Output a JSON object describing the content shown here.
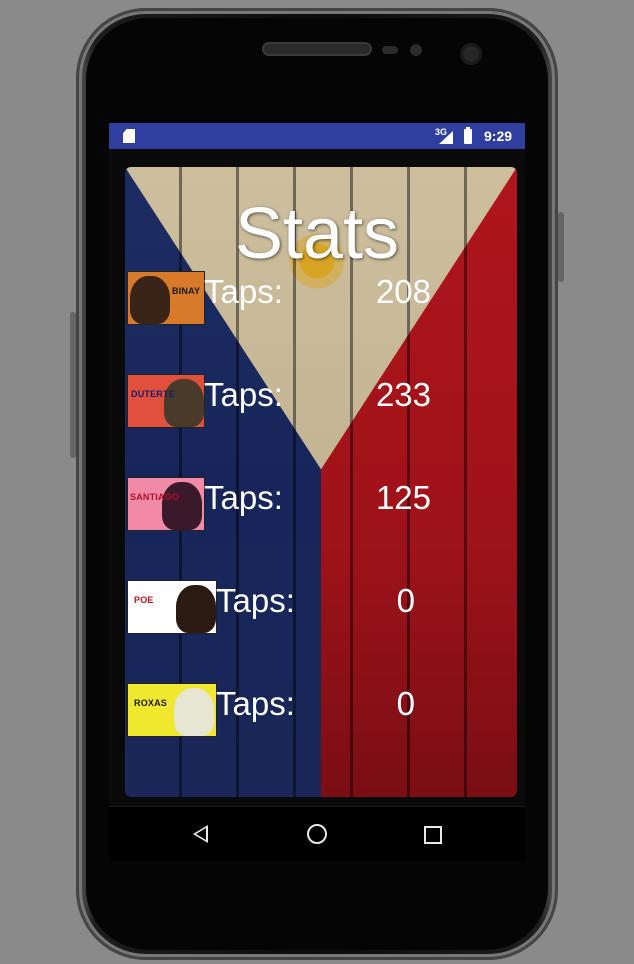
{
  "status_bar": {
    "network": "3G",
    "time": "9:29"
  },
  "page": {
    "title": "Stats"
  },
  "stats": [
    {
      "caption": "BINAY",
      "taps_label": "Taps:",
      "taps": "208",
      "thumb_bg": "#d77b2a",
      "caption_color": "#1a1a1a"
    },
    {
      "caption": "DUTERTE",
      "taps_label": "Taps:",
      "taps": "233",
      "thumb_bg": "#e0503c",
      "caption_color": "#1a1a6a"
    },
    {
      "caption": "SANTIAGO",
      "taps_label": "Taps:",
      "taps": "125",
      "thumb_bg": "#f08aa6",
      "caption_color": "#b0102a"
    },
    {
      "caption": "POE",
      "taps_label": "Taps:",
      "taps": "0",
      "thumb_bg": "#ffffff",
      "caption_color": "#c81020"
    },
    {
      "caption": "ROXAS",
      "taps_label": "Taps:",
      "taps": "0",
      "thumb_bg": "#f0e82e",
      "caption_color": "#1a1a1a"
    }
  ],
  "nav": {
    "back_icon": "back-triangle",
    "home_icon": "home-circle",
    "recents_icon": "recents-square"
  }
}
